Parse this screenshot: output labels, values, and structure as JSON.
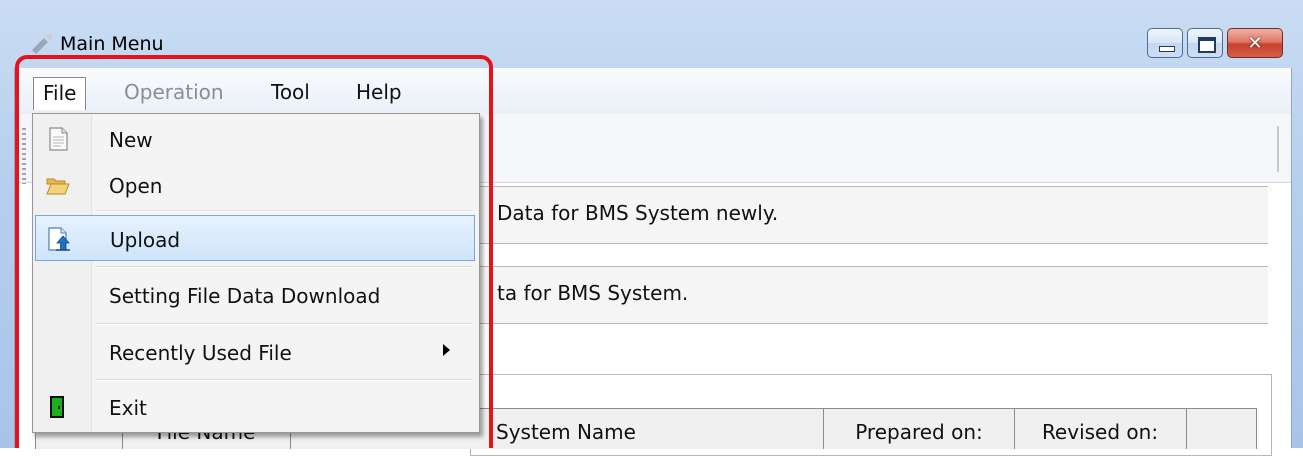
{
  "window": {
    "title": "Main Menu"
  },
  "menubar": {
    "file": "File",
    "operation": "Operation",
    "tool": "Tool",
    "help": "Help"
  },
  "file_menu": {
    "new": "New",
    "open": "Open",
    "upload": "Upload",
    "setting_download": "Setting File Data Download",
    "recent": "Recently Used File",
    "exit": "Exit"
  },
  "content": {
    "desc1": "Data for BMS System newly.",
    "desc2": "ta for BMS System."
  },
  "table": {
    "headers": [
      "",
      "File Name",
      "System Name",
      "Prepared on:",
      "Revised on:"
    ]
  },
  "colors": {
    "highlight_outline": "#e8121c",
    "selection_bg": "#cfe5fb",
    "disabled_text": "#8d8d8d"
  }
}
